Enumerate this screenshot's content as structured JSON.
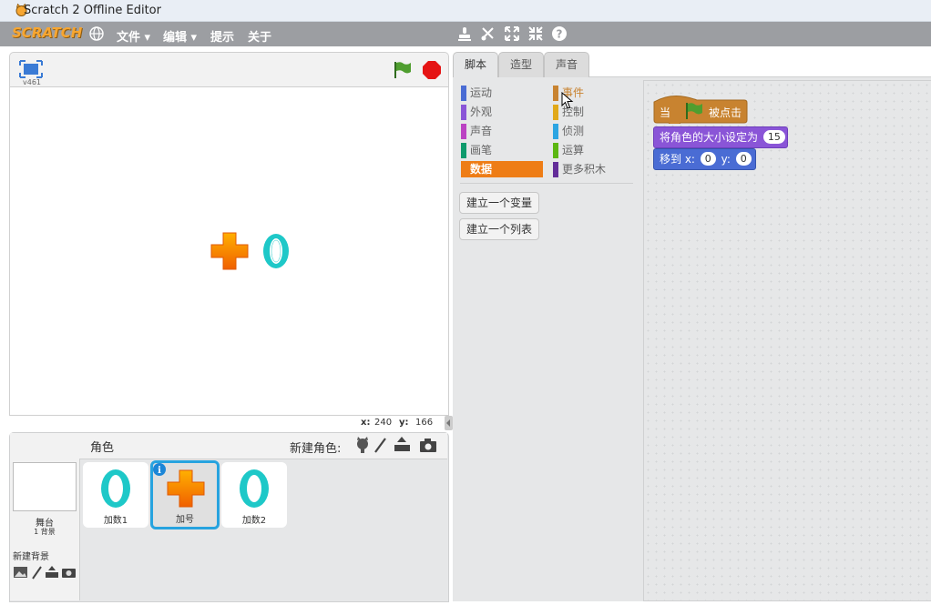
{
  "window": {
    "title": "Scratch 2 Offline Editor"
  },
  "menubar": {
    "logo": "SCRATCH",
    "items": [
      "文件 ▾",
      "编辑 ▾",
      "提示",
      "关于"
    ]
  },
  "stage": {
    "version": "v461",
    "coords_x_label": "x:",
    "coords_x": "240",
    "coords_y_label": "y:",
    "coords_y": "166",
    "numeral": "0"
  },
  "sprites": {
    "header": "角色",
    "new_sprite_label": "新建角色:",
    "stage_label": "舞台",
    "stage_sub": "1 背景",
    "new_backdrop_label": "新建背景",
    "list": [
      {
        "name": "加数1",
        "glyph": "0"
      },
      {
        "name": "加号",
        "glyph": "+"
      },
      {
        "name": "加数2",
        "glyph": "0"
      }
    ]
  },
  "tabs": [
    "脚本",
    "造型",
    "声音"
  ],
  "palette": {
    "categories_left": [
      {
        "label": "运动",
        "color": "#4a6cd4"
      },
      {
        "label": "外观",
        "color": "#8a55d7"
      },
      {
        "label": "声音",
        "color": "#bb42c3"
      },
      {
        "label": "画笔",
        "color": "#0e9a6c"
      },
      {
        "label": "数据",
        "color": "#ee7d16"
      }
    ],
    "categories_right": [
      {
        "label": "事件",
        "color": "#c88330"
      },
      {
        "label": "控制",
        "color": "#e1a91a"
      },
      {
        "label": "侦测",
        "color": "#2ca5e2"
      },
      {
        "label": "运算",
        "color": "#5cb712"
      },
      {
        "label": "更多积木",
        "color": "#632d99"
      }
    ],
    "selected": "数据",
    "buttons": [
      "建立一个变量",
      "建立一个列表"
    ]
  },
  "script": {
    "hat_when": "当",
    "hat_clicked": "被点击",
    "size_label": "将角色的大小设定为",
    "size_value": "15",
    "goto_label": "移到 x:",
    "goto_x": "0",
    "goto_y_label": "y:",
    "goto_y": "0"
  },
  "colors": {
    "events": "#c88330",
    "looks": "#8a55d7",
    "motion": "#4a6cd4",
    "selection": "#27a3df"
  }
}
